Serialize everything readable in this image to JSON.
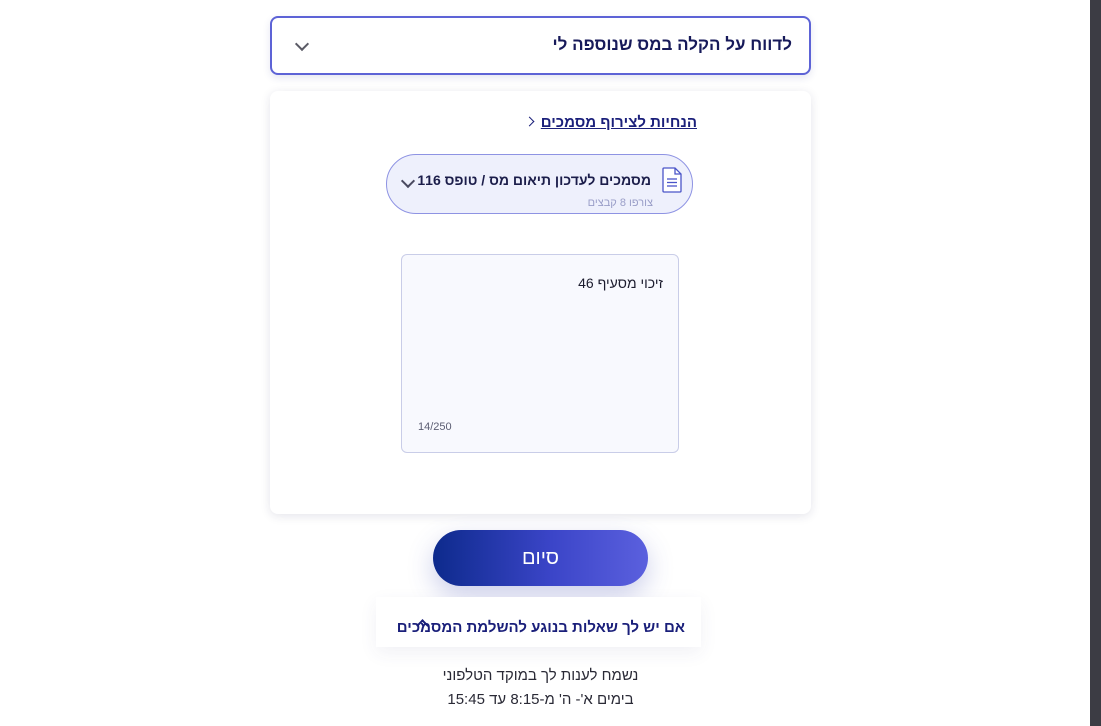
{
  "topic_select": {
    "value": "לדווח על הקלה במס שנוספה לי"
  },
  "card": {
    "guide_link": "הנחיות לצירוף מסמכים",
    "file_group": {
      "title": "מסמכים לעדכון תיאום מס / טופס 116",
      "subtitle": "צורפו 8 קבצים"
    },
    "note": {
      "text": "זיכוי מסעיף 46",
      "char_count": "14/250"
    }
  },
  "finish_button": {
    "label": "סיום"
  },
  "faq": {
    "label": "אם יש לך שאלות בנוגע להשלמת המסמכים"
  },
  "contact": {
    "line1": "נשמח לענות לך במוקד הטלפוני",
    "line2": "בימים א'- ה' מ-8:15 עד 15:45"
  },
  "colors": {
    "accent": "#5d63d6",
    "brand_dark": "#1a1f7a",
    "button_gradient_start": "#0d2a8c",
    "button_gradient_end": "#5b60de"
  },
  "icons": {
    "topic_chevron": "chevron-down-icon",
    "guide_chevron": "chevron-left-icon",
    "file": "document-icon",
    "file_chevron": "chevron-down-icon",
    "faq_chevron": "chevron-up-icon"
  }
}
